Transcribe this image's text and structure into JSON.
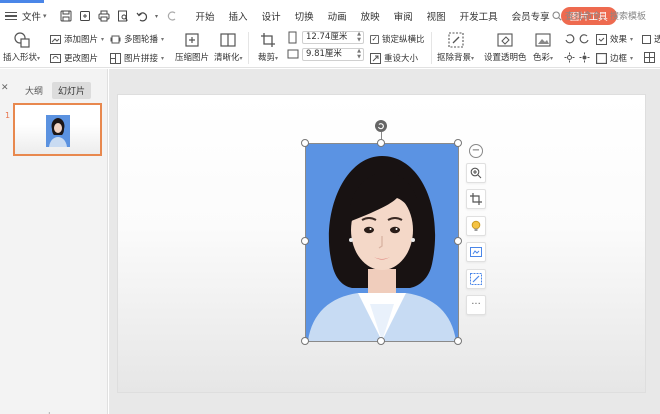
{
  "menubar": {
    "file_label": "文件",
    "tabs": [
      "开始",
      "插入",
      "设计",
      "切换",
      "动画",
      "放映",
      "审阅",
      "视图",
      "开发工具",
      "会员专享"
    ],
    "active_tab": "图片工具",
    "search_placeholder": "查找命令、搜索模板"
  },
  "ribbon": {
    "insert_shape": "插入形状",
    "add_image": "添加图片",
    "change_image": "更改图片",
    "multi_carousel": "多图轮播",
    "image_collage": "图片拼接",
    "compress_image": "压缩图片",
    "sharpen": "清晰化",
    "crop": "裁剪",
    "height_value": "12.74厘米",
    "width_value": "9.81厘米",
    "lock_ratio": "锁定纵横比",
    "reset_size": "重设大小",
    "remove_background": "抠除背景",
    "set_transparent": "设置透明色",
    "color": "色彩",
    "effects": "效果",
    "border": "边框",
    "transparency_short": "透"
  },
  "left_panel": {
    "outline_tab": "大纲",
    "slides_tab": "幻灯片",
    "slide_number": "1"
  },
  "colors": {
    "accent": "#4a86e8",
    "picture_tools_tab": "#ee6a4f",
    "thumbnail_selection": "#e8884e",
    "photo_background": "#5b93e3"
  },
  "float_toolbar": [
    "minus-icon",
    "zoom-icon",
    "crop-icon",
    "bulb-icon",
    "image-ratio-icon",
    "image-edit-icon",
    "more-icon"
  ]
}
